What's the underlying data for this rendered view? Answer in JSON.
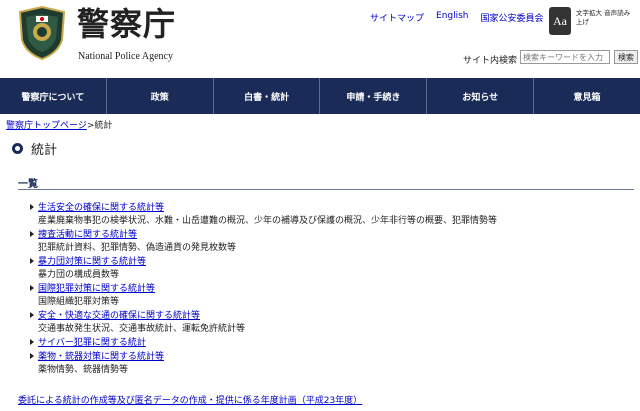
{
  "header": {
    "logo_title": "警察庁",
    "logo_sub": "National Police Agency",
    "top_links": [
      "サイトマップ",
      "English",
      "国家公安委員会"
    ],
    "accessibility_label": "文字拡大 音声読み上げ",
    "accessibility_button": "Aa",
    "search_label": "サイト内検索",
    "search_placeholder": "検索キーワードを入力",
    "search_button": "検索"
  },
  "nav": {
    "items": [
      "警察庁について",
      "政策",
      "白書・統計",
      "申請・手続き",
      "お知らせ",
      "意見箱"
    ]
  },
  "breadcrumb": {
    "parent": "警察庁トップページ",
    "separator": ">",
    "current": "統計"
  },
  "page": {
    "title": "統計",
    "section_title": "一覧"
  },
  "stats": [
    {
      "link": "生活安全の確保に関する統計等",
      "desc": "産業廃棄物事犯の検挙状況、水難・山岳遭難の概況、少年の補導及び保護の概況、少年非行等の概要、犯罪情勢等"
    },
    {
      "link": "捜査活動に関する統計等",
      "desc": "犯罪統計資料、犯罪情勢、偽造通貨の発見枚数等"
    },
    {
      "link": "暴力団対策に関する統計等",
      "desc": "暴力団の構成員数等"
    },
    {
      "link": "国際犯罪対策に関する統計等",
      "desc": "国際組織犯罪対策等"
    },
    {
      "link": "安全・快適な交通の確保に関する統計等",
      "desc": "交通事故発生状況、交通事故統計、運転免許統計等"
    },
    {
      "link": "サイバー犯罪に関する統計",
      "desc": ""
    },
    {
      "link": "薬物・銃器対策に関する統計等",
      "desc": "薬物情勢、銃器情勢等"
    }
  ],
  "bottom_link": "委託による統計の作成等及び匿名データの作成・提供に係る年度計画（平成23年度）",
  "colors": {
    "nav_bg": "#1a2b57",
    "link": "#0000cc"
  }
}
